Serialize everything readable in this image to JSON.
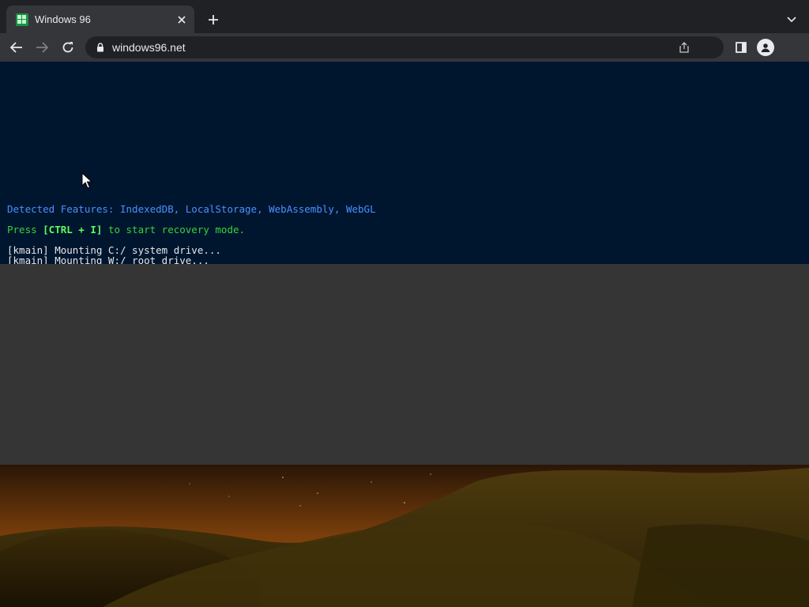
{
  "tab": {
    "title": "Windows 96",
    "favicon": "windows-logo-icon"
  },
  "toolbar": {
    "url": "windows96.net"
  },
  "console": {
    "features": "Detected Features: IndexedDB, LocalStorage, WebAssembly, WebGL",
    "recovery_pre": "Press ",
    "recovery_key": "[CTRL + I]",
    "recovery_post": " to start recovery mode.",
    "log": [
      "[kmain] Mounting C:/ system drive...",
      "[kmain] Mounting W:/ root drive..."
    ]
  },
  "colors": {
    "console_bg": "#00162f",
    "feature_text": "#4a90ff",
    "recovery_text": "#38d23a",
    "log_text": "#e8e8e8",
    "blank_area": "#353535"
  }
}
